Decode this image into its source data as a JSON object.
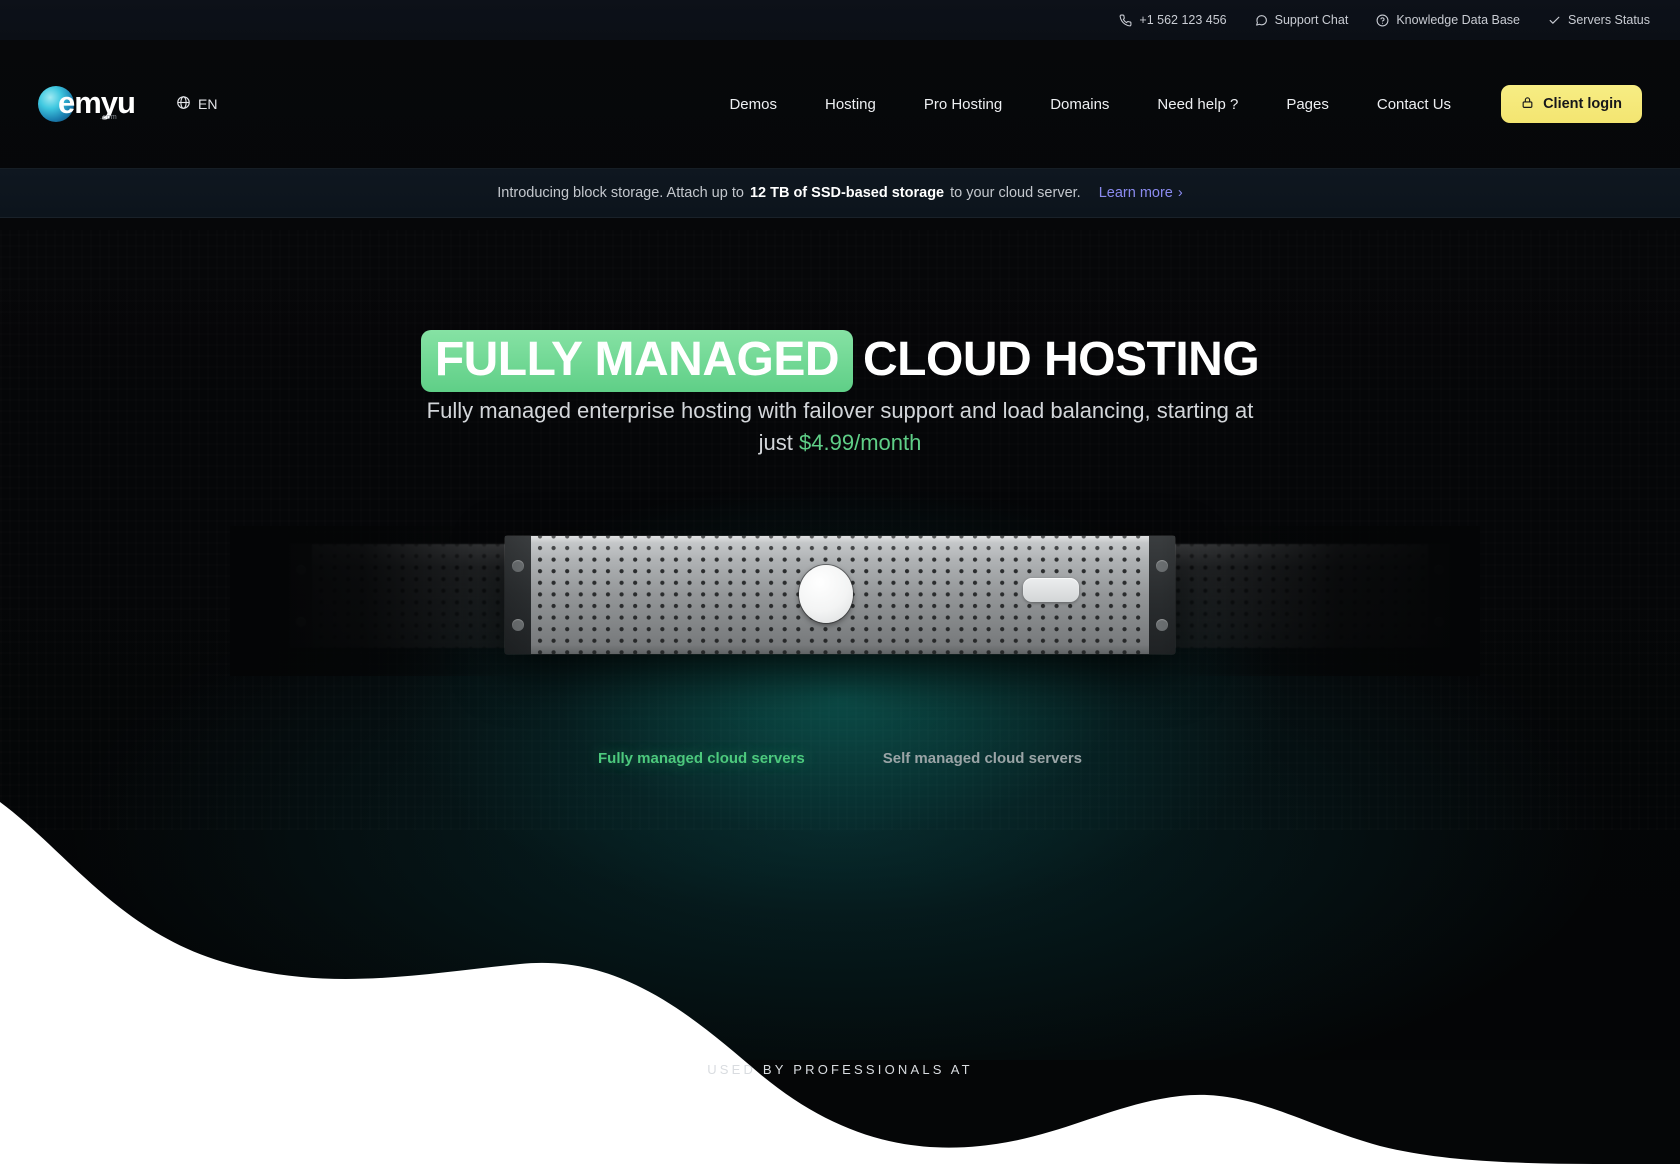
{
  "topbar": {
    "items": [
      {
        "icon": "phone-icon",
        "label": "+1 562 123 456"
      },
      {
        "icon": "chat-bubble-icon",
        "label": "Support Chat"
      },
      {
        "icon": "question-circle-icon",
        "label": "Knowledge Data Base"
      },
      {
        "icon": "check-icon",
        "label": "Servers Status"
      }
    ]
  },
  "nav": {
    "logo_text": "emyu",
    "logo_sub": ".com",
    "lang_icon": "globe-icon",
    "lang_label": "EN",
    "links": [
      {
        "label": "Demos"
      },
      {
        "label": "Hosting"
      },
      {
        "label": "Pro Hosting"
      },
      {
        "label": "Domains"
      },
      {
        "label": "Need help ?"
      },
      {
        "label": "Pages"
      },
      {
        "label": "Contact Us"
      }
    ],
    "login": {
      "icon": "lock-icon",
      "label": "Client login"
    }
  },
  "announcement": {
    "text_before": "Introducing block storage. Attach up to",
    "highlight": "12 TB of SSD-based storage",
    "text_after": "to your cloud server.",
    "link_label": "Learn more",
    "link_chevron": "›",
    "link_color": "#8b8bf0"
  },
  "hero": {
    "title_highlight": "FULLY MANAGED",
    "title_rest": "CLOUD HOSTING",
    "highlight_color": "#5fcf87",
    "subtitle_line1": "Fully managed enterprise hosting with failover support and load balancing, starting at",
    "subtitle_just": "just",
    "subtitle_price": "$4.99/month",
    "price_color": "#5fcf87"
  },
  "server_tabs": [
    {
      "label": "Fully managed cloud servers",
      "active": true
    },
    {
      "label": "Self managed cloud servers",
      "active": false
    }
  ],
  "used_by": {
    "label": "USED BY PROFESSIONALS AT"
  }
}
